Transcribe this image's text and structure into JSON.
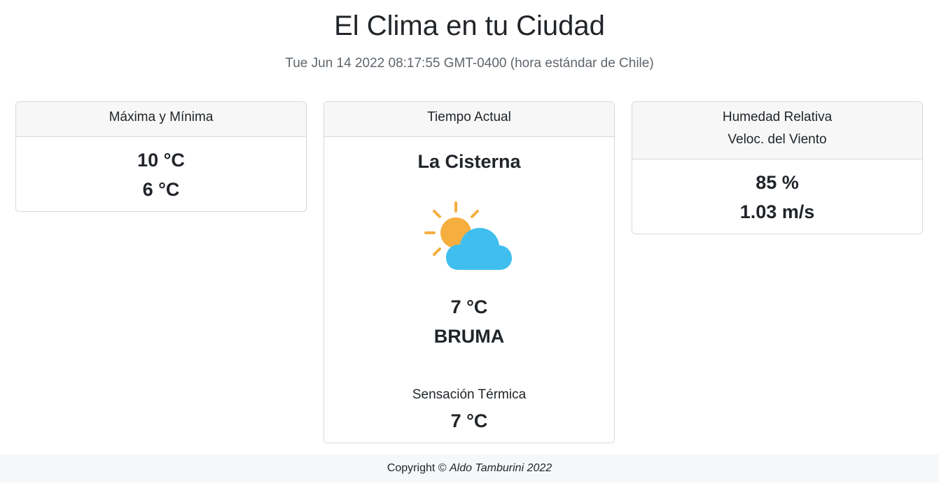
{
  "page": {
    "title": "El Clima en tu Ciudad",
    "datetime": "Tue Jun 14 2022 08:17:55 GMT-0400 (hora estándar de Chile)"
  },
  "minmax": {
    "header": "Máxima y Mínima",
    "max": "10 °C",
    "min": "6 °C"
  },
  "current": {
    "header": "Tiempo Actual",
    "city": "La Cisterna",
    "icon": "partly-cloudy-icon",
    "temp": "7 °C",
    "description": "BRUMA",
    "feels_label": "Sensación Térmica",
    "feels_value": "7 °C"
  },
  "humidity": {
    "header_line1": "Humedad Relativa",
    "header_line2": "Veloc. del Viento",
    "humidity": "85 %",
    "wind": "1.03 m/s"
  },
  "footer": {
    "copyright": "Copyright ©",
    "author": "Aldo Tamburini 2022"
  },
  "colors": {
    "sun": "#f6ae3f",
    "cloud": "#40bfef",
    "header_bg": "#f7f7f7",
    "footer_bg": "#f6f7f8"
  }
}
